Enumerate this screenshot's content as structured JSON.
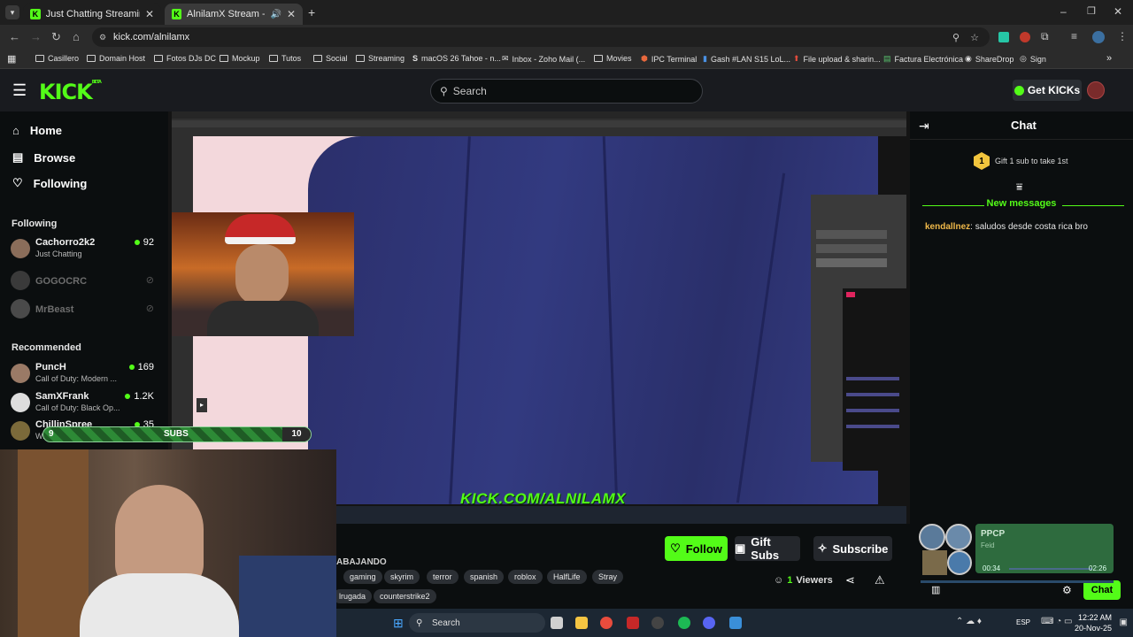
{
  "browser": {
    "tabs": [
      {
        "title": "Just Chatting Streaming - Live S"
      },
      {
        "title": "AlnilamX Stream - Watch Li"
      }
    ],
    "url": "kick.com/alnilamx",
    "bookmarks": [
      "Casillero",
      "Domain Host",
      "Fotos DJs DC",
      "Mockup",
      "Tutos",
      "Social",
      "Streaming",
      "macOS 26 Tahoe - n...",
      "Inbox - Zoho Mail (...",
      "Movies",
      "IPC Terminal",
      "Gash #LAN S15 LoL...",
      "File upload & sharin...",
      "Factura Electrónica",
      "ShareDrop",
      "Sign"
    ]
  },
  "header": {
    "logo": "KICK",
    "logo_sup": "BETA",
    "search_placeholder": "Search",
    "get_kicks": "Get KICKs"
  },
  "sidebar": {
    "nav": [
      {
        "label": "Home"
      },
      {
        "label": "Browse"
      },
      {
        "label": "Following"
      }
    ],
    "following_title": "Following",
    "following": [
      {
        "name": "Cachorro2k2",
        "category": "Just Chatting",
        "viewers": "92"
      },
      {
        "name": "GOGOCRC"
      },
      {
        "name": "MrBeast"
      }
    ],
    "recommended_title": "Recommended",
    "recommended": [
      {
        "name": "PuncH",
        "category": "Call of Duty: Modern ...",
        "viewers": "169"
      },
      {
        "name": "SamXFrank",
        "category": "Call of Duty: Black Op...",
        "viewers": "1.2K"
      },
      {
        "name": "ChillinSpree",
        "category": "W...",
        "viewers": "35"
      }
    ]
  },
  "overlay": {
    "watermark": "KICK.COM/ALNILAMX",
    "subs_label": "SUBS",
    "subs_current": "9",
    "subs_goal": "10",
    "subs_progress": 0.9
  },
  "stream_info": {
    "title_fragment": "ABAJANDO",
    "tags": [
      "gaming",
      "skyrim",
      "terror",
      "spanish",
      "roblox",
      "HalfLife",
      "Stray",
      "lrugada",
      "counterstrike2"
    ],
    "follow_label": "Follow",
    "gift_label": "Gift Subs",
    "subscribe_label": "Subscribe",
    "viewers_count": "1",
    "viewers_label": "Viewers"
  },
  "chat": {
    "title": "Chat",
    "gift_badge": "1",
    "gift_text": "Gift 1 sub to take 1st",
    "new_messages": "New messages",
    "messages": [
      {
        "user": "kendallnez",
        "text": "saludos desde costa rica bro"
      }
    ],
    "chat_button": "Chat"
  },
  "music": {
    "title": "PPCP",
    "artist": "Feid",
    "elapsed": "00:34",
    "duration": "02:26"
  },
  "taskbar": {
    "search": "Search",
    "lang": "ESP",
    "time": "12:22 AM",
    "date": "20-Nov-25"
  },
  "colors": {
    "accent": "#53fc18",
    "bg": "#0b0e0f",
    "panel": "#191b1f"
  }
}
